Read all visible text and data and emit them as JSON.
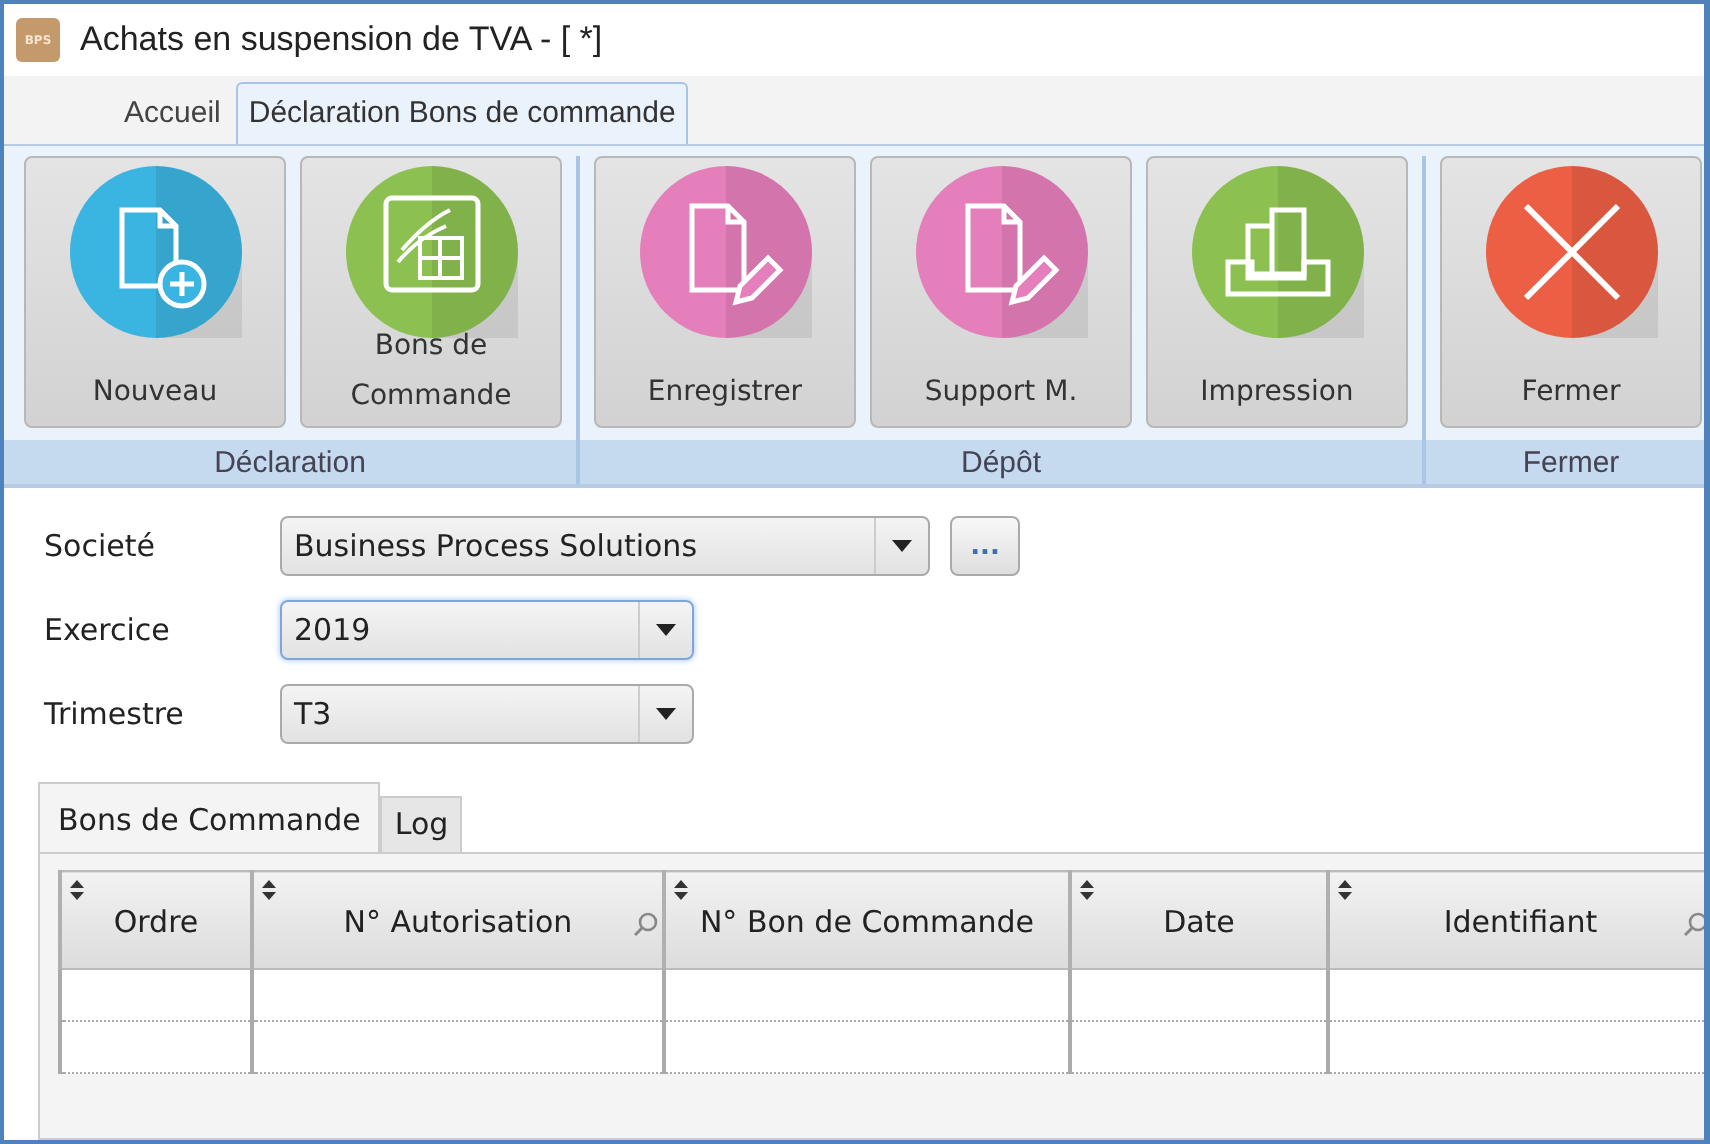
{
  "window": {
    "title": "Achats en suspension de TVA - [ *]",
    "logo": "BPS"
  },
  "ribbon_tabs": [
    {
      "label": "Accueil",
      "selected": false
    },
    {
      "label": "Déclaration Bons de commande",
      "selected": true
    }
  ],
  "ribbon_groups": [
    {
      "label": "Déclaration",
      "buttons": [
        {
          "label": "Nouveau",
          "kind": "new",
          "color": "#3ab4e0"
        },
        {
          "label": "Bons de\nCommande",
          "kind": "orders",
          "color": "#8cc152"
        }
      ]
    },
    {
      "label": "Dépôt",
      "buttons": [
        {
          "label": "Enregistrer",
          "kind": "edit",
          "color": "#e57fbb"
        },
        {
          "label": "Support M.",
          "kind": "edit",
          "color": "#e57fbb"
        },
        {
          "label": "Impression",
          "kind": "print",
          "color": "#8cc152"
        }
      ]
    },
    {
      "label": "Fermer",
      "buttons": [
        {
          "label": "Fermer",
          "kind": "close",
          "color": "#ec5f45"
        }
      ]
    }
  ],
  "form_fields": [
    {
      "label": "Societé",
      "value": "Business Process Solutions",
      "focused": false,
      "extra_button": "..."
    },
    {
      "label": "Exercice",
      "value": "2019",
      "focused": true
    },
    {
      "label": "Trimestre",
      "value": "T3",
      "focused": false
    }
  ],
  "inner_tabs": [
    {
      "label": "Bons de Commande",
      "selected": true
    },
    {
      "label": "Log",
      "selected": false
    }
  ],
  "table": {
    "columns": [
      {
        "label": "Ordre",
        "searchable": false
      },
      {
        "label": "N° Autorisation",
        "searchable": true
      },
      {
        "label": "N° Bon de Commande",
        "searchable": false
      },
      {
        "label": "Date",
        "searchable": false
      },
      {
        "label": "Identifiant",
        "searchable": true
      }
    ]
  }
}
